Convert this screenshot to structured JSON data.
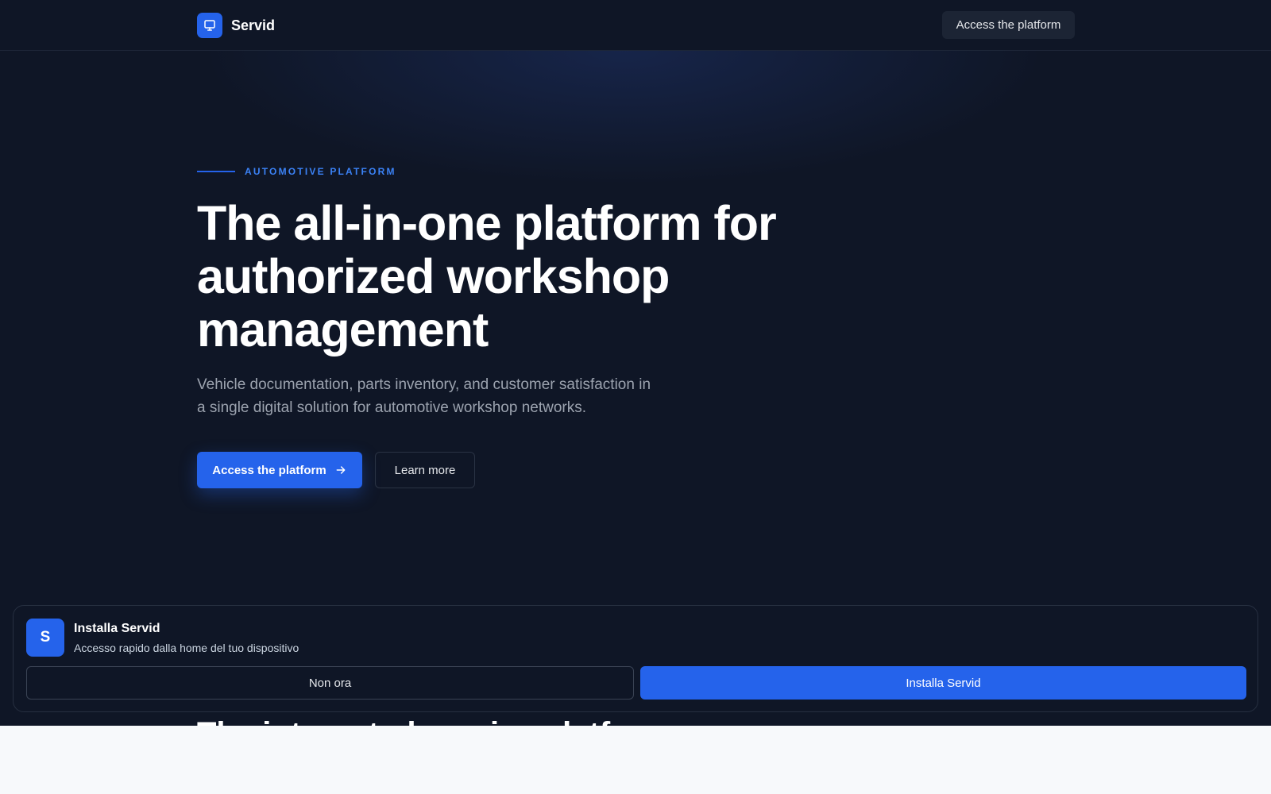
{
  "header": {
    "brand_name": "Servid",
    "cta_label": "Access the platform"
  },
  "hero": {
    "eyebrow": "AUTOMOTIVE PLATFORM",
    "title": "The all-in-one platform for authorized workshop management",
    "subtitle": "Vehicle documentation, parts inventory, and customer satisfaction in a single digital solution for automotive workshop networks.",
    "primary_label": "Access the platform",
    "secondary_label": "Learn more"
  },
  "next_section": {
    "title_partial": "The integrated service platform"
  },
  "install_banner": {
    "icon_letter": "S",
    "title": "Installa Servid",
    "description": "Accesso rapido dalla home del tuo dispositivo",
    "dismiss_label": "Non ora",
    "install_label": "Installa Servid"
  },
  "colors": {
    "background": "#0f1626",
    "accent": "#2563eb",
    "eyebrow": "#3b82f6",
    "muted_text": "#9ca3af"
  }
}
